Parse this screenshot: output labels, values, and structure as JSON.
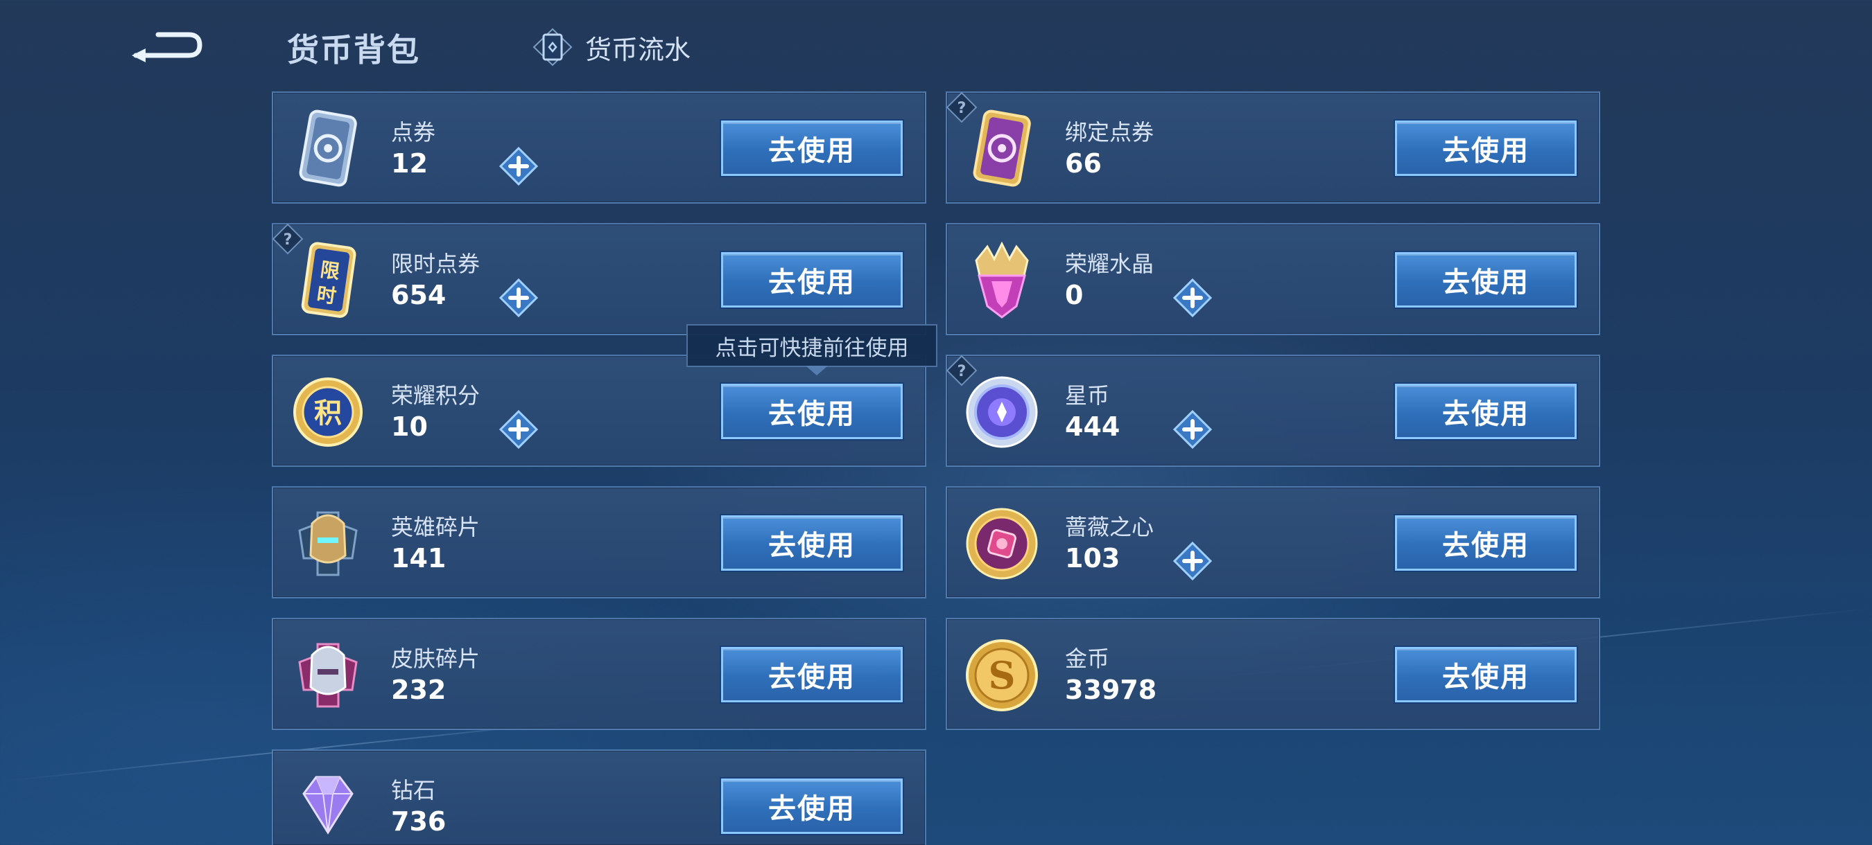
{
  "header": {
    "title": "货币背包",
    "flow_label": "货币流水"
  },
  "use_label": "去使用",
  "tooltip": "点击可快捷前往使用",
  "currencies": [
    {
      "name": "点券",
      "amount": "12"
    },
    {
      "name": "绑定点券",
      "amount": "66"
    },
    {
      "name": "限时点券",
      "amount": "654"
    },
    {
      "name": "荣耀水晶",
      "amount": "0"
    },
    {
      "name": "荣耀积分",
      "amount": "10"
    },
    {
      "name": "星币",
      "amount": "444"
    },
    {
      "name": "英雄碎片",
      "amount": "141"
    },
    {
      "name": "蔷薇之心",
      "amount": "103"
    },
    {
      "name": "皮肤碎片",
      "amount": "232"
    },
    {
      "name": "金币",
      "amount": "33978"
    },
    {
      "name": "钻石",
      "amount": "736"
    }
  ],
  "icons": {
    "back": "back-arrow-icon",
    "flow": "currency-flow-icon",
    "plus": "plus-icon",
    "help": "question-icon"
  },
  "colors": {
    "accent": "#8cc7ff",
    "button": "#2f6fba"
  }
}
